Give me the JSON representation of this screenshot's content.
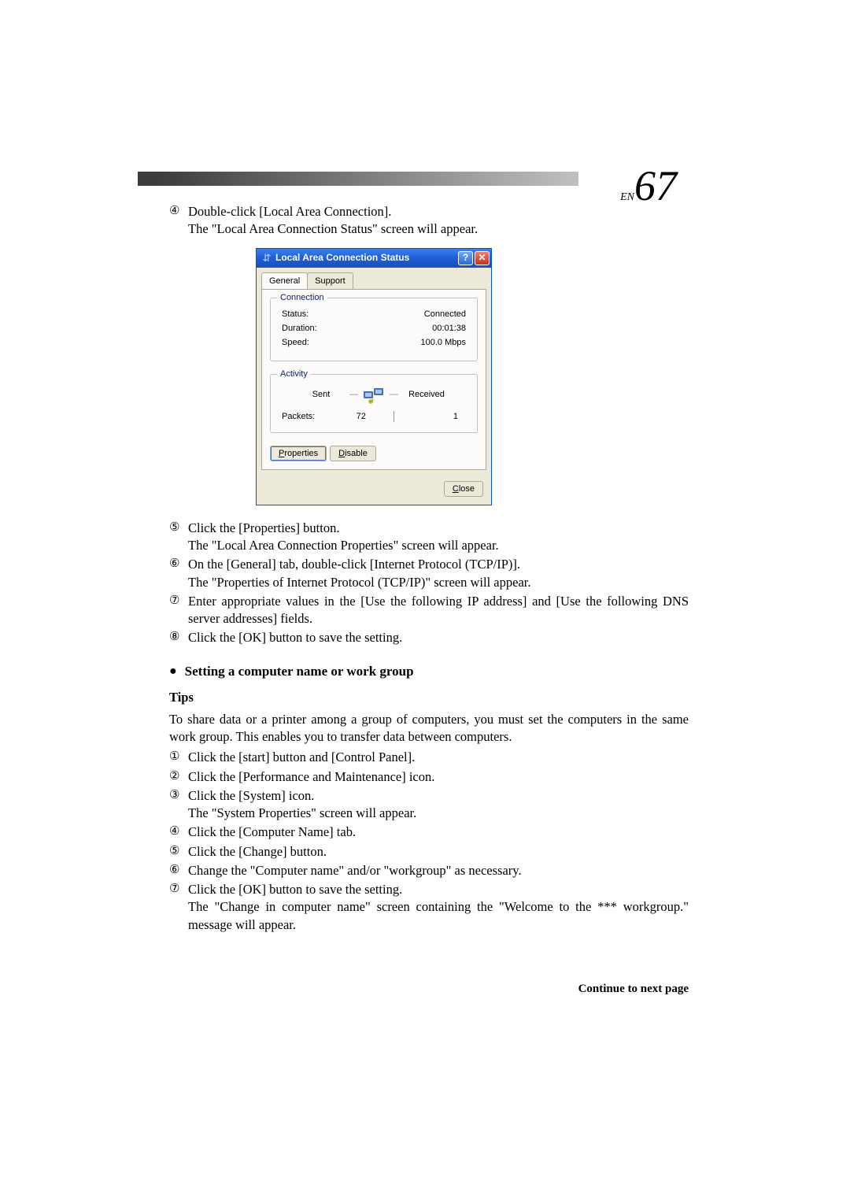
{
  "page": {
    "en_prefix": "EN",
    "number": "67",
    "continue": "Continue to next page"
  },
  "intro_steps": {
    "s4_marker": "④",
    "s4_line1": "Double-click [Local Area Connection].",
    "s4_line2": "The \"Local Area Connection Status\" screen will appear.",
    "s5_marker": "⑤",
    "s5_line1": "Click the [Properties] button.",
    "s5_line2": "The \"Local Area Connection Properties\" screen will appear.",
    "s6_marker": "⑥",
    "s6_line1": "On the [General] tab, double-click [Internet Protocol (TCP/IP)].",
    "s6_line2": "The \"Properties of Internet Protocol (TCP/IP)\" screen will appear.",
    "s7_marker": "⑦",
    "s7_line1": "Enter appropriate values in the [Use the following IP address] and [Use the following DNS server addresses] fields.",
    "s8_marker": "⑧",
    "s8_line1": "Click the [OK] button to save the setting."
  },
  "dialog": {
    "title": "Local Area Connection Status",
    "tab_general": "General",
    "tab_support": "Support",
    "group_connection": "Connection",
    "status_label": "Status:",
    "status_value": "Connected",
    "duration_label": "Duration:",
    "duration_value": "00:01:38",
    "speed_label": "Speed:",
    "speed_value": "100.0 Mbps",
    "group_activity": "Activity",
    "sent_label": "Sent",
    "received_label": "Received",
    "packets_label": "Packets:",
    "packets_sent": "72",
    "packets_received": "1",
    "properties_btn_p": "P",
    "properties_btn_rest": "roperties",
    "disable_btn_d": "D",
    "disable_btn_rest": "isable",
    "close_btn_c": "C",
    "close_btn_rest": "lose"
  },
  "section2": {
    "heading": "Setting a computer name or work group",
    "tips": "Tips",
    "para": "To share data or a printer among a group of computers, you must set the computers in the same work group.  This enables you to transfer data between computers.",
    "steps": {
      "s1_marker": "①",
      "s1": "Click the [start] button and [Control Panel].",
      "s2_marker": "②",
      "s2": "Click the [Performance and Maintenance] icon.",
      "s3_marker": "③",
      "s3a": "Click the [System] icon.",
      "s3b": "The \"System Properties\" screen will appear.",
      "s4_marker": "④",
      "s4": "Click the [Computer Name] tab.",
      "s5_marker": "⑤",
      "s5": "Click the [Change] button.",
      "s6_marker": "⑥",
      "s6": "Change the \"Computer name\" and/or \"workgroup\" as necessary.",
      "s7_marker": "⑦",
      "s7a": "Click the [OK] button to save the setting.",
      "s7b": "The \"Change in computer name\" screen containing the \"Welcome to the *** workgroup.\" message will appear."
    }
  }
}
